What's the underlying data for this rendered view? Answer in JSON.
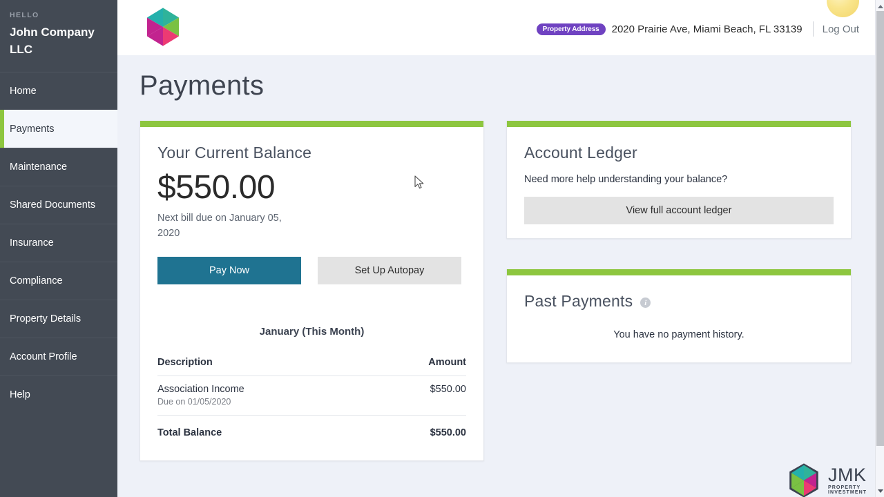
{
  "sidebar": {
    "hello_label": "HELLO",
    "account_name": "John Company LLC",
    "items": [
      {
        "label": "Home",
        "active": false
      },
      {
        "label": "Payments",
        "active": true
      },
      {
        "label": "Maintenance",
        "active": false
      },
      {
        "label": "Shared Documents",
        "active": false
      },
      {
        "label": "Insurance",
        "active": false
      },
      {
        "label": "Compliance",
        "active": false
      },
      {
        "label": "Property Details",
        "active": false
      },
      {
        "label": "Account Profile",
        "active": false
      },
      {
        "label": "Help",
        "active": false
      }
    ]
  },
  "header": {
    "address_badge": "Property Address",
    "address": "2020 Prairie Ave, Miami Beach, FL 33139",
    "logout": "Log Out"
  },
  "page": {
    "title": "Payments"
  },
  "balance_card": {
    "title": "Your Current Balance",
    "amount": "$550.00",
    "next_bill": "Next bill due on January 05, 2020",
    "pay_now_label": "Pay Now",
    "autopay_label": "Set Up Autopay",
    "month_label": "January (This Month)",
    "columns": [
      "Description",
      "Amount"
    ],
    "rows": [
      {
        "description": "Association Income",
        "due": "Due on 01/05/2020",
        "amount": "$550.00"
      }
    ],
    "total_label": "Total Balance",
    "total_amount": "$550.00"
  },
  "ledger_card": {
    "title": "Account Ledger",
    "help_text": "Need more help understanding your balance?",
    "button_label": "View full account ledger"
  },
  "past_payments_card": {
    "title": "Past Payments",
    "info_icon": "info-icon",
    "empty_text": "You have no payment history."
  },
  "footer_logo": {
    "name": "JMK",
    "tagline": "PROPERTY INVESTMENT"
  },
  "colors": {
    "sidebar_bg": "#434a54",
    "accent_green": "#8dc63f",
    "primary_button": "#1f7391",
    "badge_purple": "#6f42c1",
    "page_bg": "#eef1f8"
  }
}
